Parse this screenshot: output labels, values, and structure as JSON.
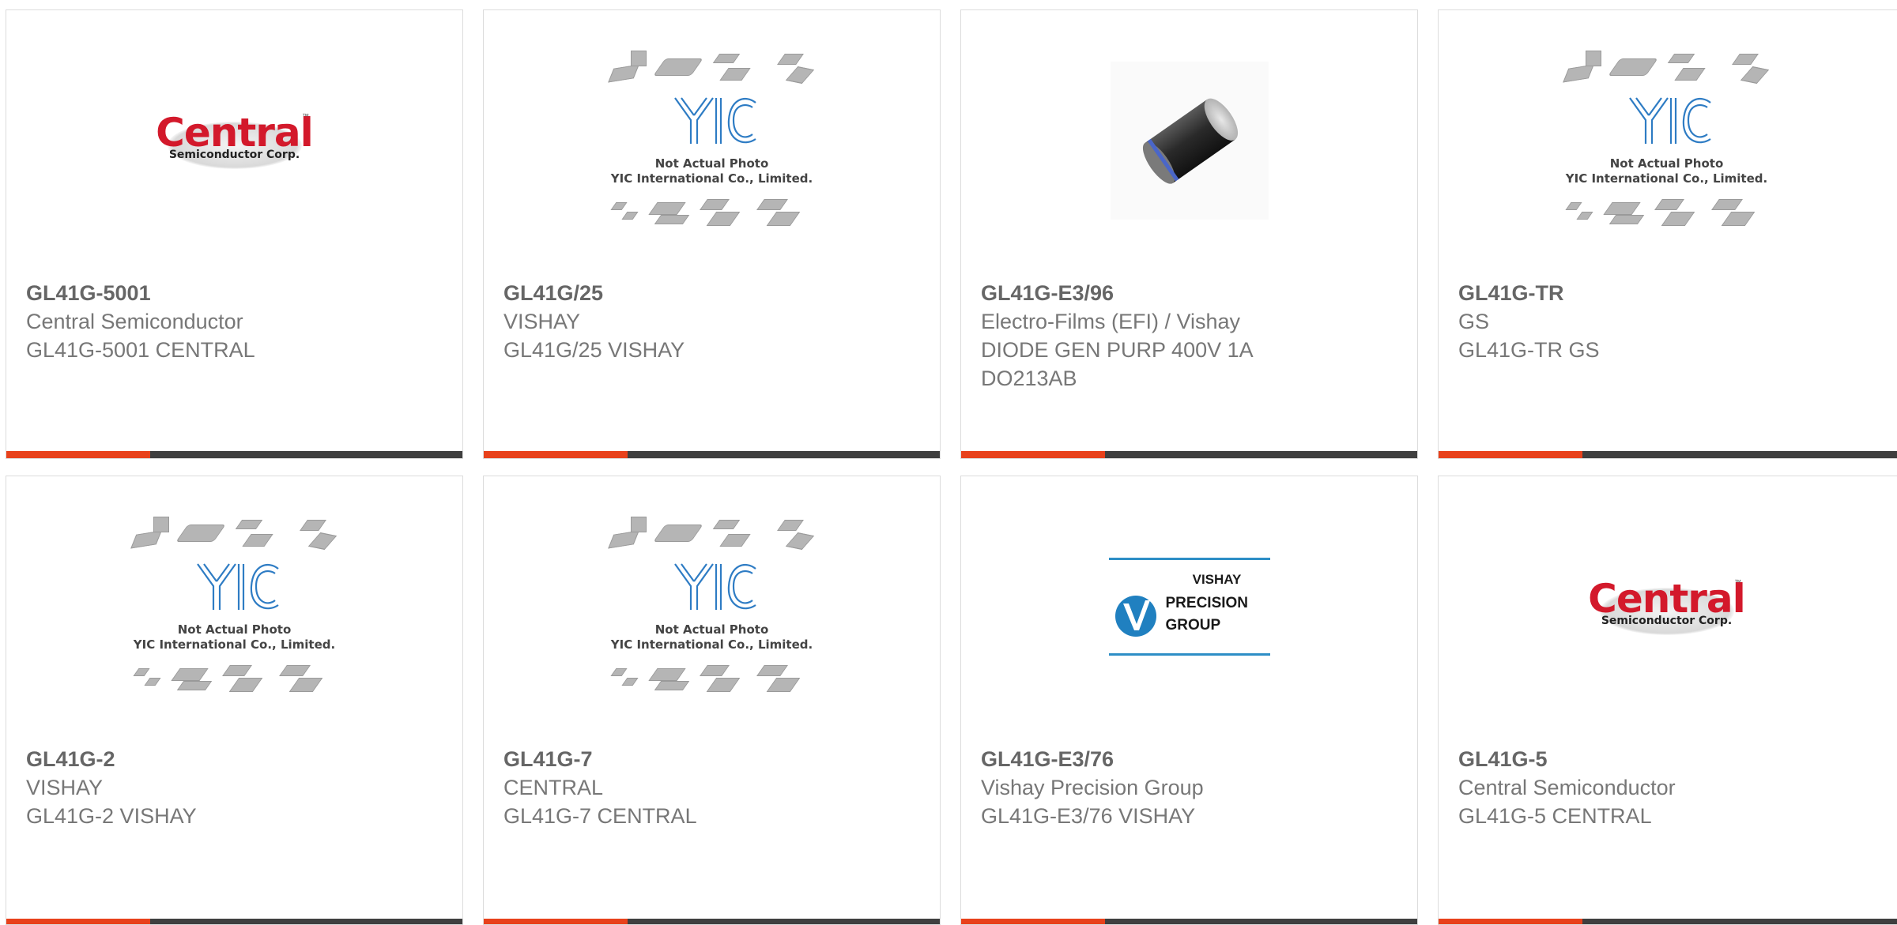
{
  "colors": {
    "accent": "#e8411b",
    "bar": "#3f3f3f",
    "central_red": "#d3192b",
    "vishay_blue": "#2d8ec6"
  },
  "cards": [
    {
      "part": "GL41G-5001",
      "manufacturer": "Central Semiconductor",
      "description": "GL41G-5001 CENTRAL",
      "image": "central-logo"
    },
    {
      "part": "GL41G/25",
      "manufacturer": "VISHAY",
      "description": "GL41G/25 VISHAY",
      "image": "yic-placeholder"
    },
    {
      "part": "GL41G-E3/96",
      "manufacturer": "Electro-Films (EFI) / Vishay",
      "description": "DIODE GEN PURP 400V 1A DO213AB",
      "image": "diode-photo"
    },
    {
      "part": "GL41G-TR",
      "manufacturer": "GS",
      "description": "GL41G-TR GS",
      "image": "yic-placeholder"
    },
    {
      "part": "GL41G-2",
      "manufacturer": "VISHAY",
      "description": "GL41G-2 VISHAY",
      "image": "yic-placeholder"
    },
    {
      "part": "GL41G-7",
      "manufacturer": "CENTRAL",
      "description": "GL41G-7 CENTRAL",
      "image": "yic-placeholder"
    },
    {
      "part": "GL41G-E3/76",
      "manufacturer": "Vishay Precision Group",
      "description": "GL41G-E3/76 VISHAY",
      "image": "vishay-precision-logo"
    },
    {
      "part": "GL41G-5",
      "manufacturer": "Central Semiconductor",
      "description": "GL41G-5 CENTRAL",
      "image": "central-logo"
    }
  ],
  "central_logo": {
    "word": "Central",
    "tm": "™",
    "sub": "Semiconductor Corp."
  },
  "yic_placeholder": {
    "line1": "Not Actual Photo",
    "line2": "YIC International Co., Limited."
  },
  "vpg_logo": {
    "brand": "VISHAY",
    "line1": "PRECISION",
    "line2": "GROUP"
  }
}
